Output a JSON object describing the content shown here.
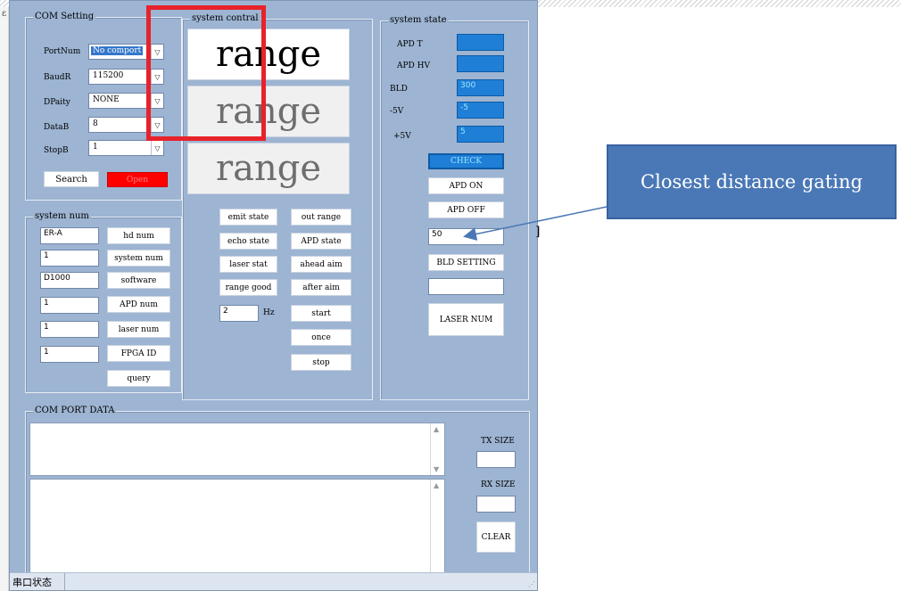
{
  "side_mark": "ε",
  "com_setting": {
    "legend": "COM Setting",
    "rows": [
      {
        "label": "PortNum",
        "value": "No comport",
        "selected": true
      },
      {
        "label": "BaudR",
        "value": "115200",
        "selected": false
      },
      {
        "label": "DPaity",
        "value": "NONE",
        "selected": false
      },
      {
        "label": "DataB",
        "value": "8",
        "selected": false
      },
      {
        "label": "StopB",
        "value": "1",
        "selected": false
      }
    ],
    "search_label": "Search",
    "open_label": "Open",
    "open_color": "#ff0000"
  },
  "system_num": {
    "legend": "system num",
    "rows": [
      {
        "value": "ER-A",
        "button": "hd num"
      },
      {
        "value": "1",
        "button": "system num"
      },
      {
        "value": "D1000",
        "button": "software"
      },
      {
        "value": "1",
        "button": "APD num"
      },
      {
        "value": "1",
        "button": "laser num"
      },
      {
        "value": "1",
        "button": "FPGA ID"
      }
    ],
    "query_label": "query"
  },
  "system_control": {
    "legend": "system contral",
    "range_displays": [
      "range",
      "range",
      "range"
    ],
    "state_buttons": [
      "emit state",
      "echo state",
      "laser stat",
      "range good"
    ],
    "aim_buttons": [
      "out range",
      "APD state",
      "ahead aim",
      "after aim"
    ],
    "freq_value": "2",
    "freq_unit": "Hz",
    "start_label": "start",
    "once_label": "once",
    "stop_label": "stop"
  },
  "system_state": {
    "legend": "system state",
    "fields": [
      {
        "label": "APD T",
        "value": ""
      },
      {
        "label": "APD HV",
        "value": ""
      },
      {
        "label": "BLD",
        "value": "300"
      },
      {
        "label": "-5V",
        "value": "-5"
      },
      {
        "label": "+5V",
        "value": "5"
      }
    ],
    "check_label": "CHECK",
    "apd_on_label": "APD ON",
    "apd_off_label": "APD OFF",
    "gate_value": "50",
    "bld_setting_label": "BLD SETTING",
    "blank_value": "",
    "laser_num_label": "LASER NUM",
    "value_color": "#1f7fd6"
  },
  "com_port_data": {
    "legend": "COM PORT DATA",
    "tx_size_label": "TX SIZE",
    "rx_size_label": "RX SIZE",
    "tx_value": "",
    "rx_value": "",
    "clear_label": "CLEAR"
  },
  "status_bar": {
    "text": "串口状态"
  },
  "annotation": {
    "callout_text": "Closest distance gating",
    "callout_color": "#4a78b6",
    "highlight_color": "#e8222a",
    "arrow_color": "#4a78b6",
    "bracket": "]"
  }
}
